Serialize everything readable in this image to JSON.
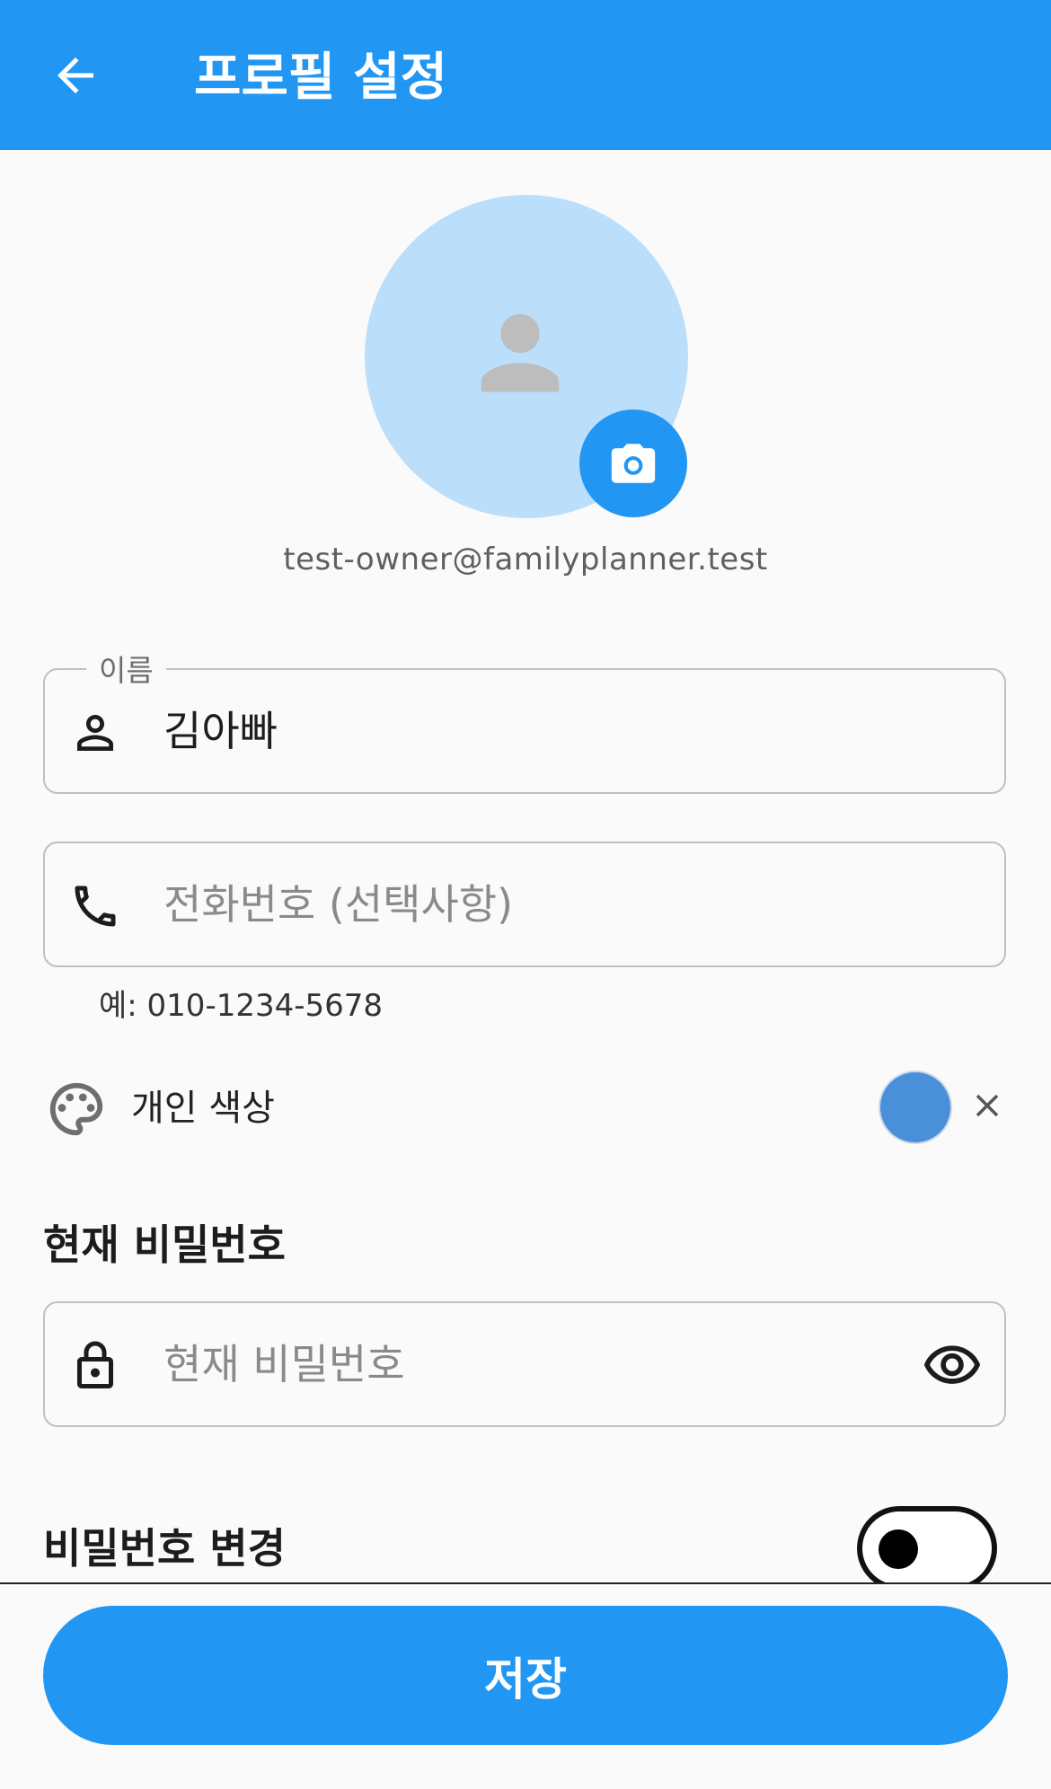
{
  "header": {
    "title": "프로필 설정",
    "back_icon": "arrow-back-icon"
  },
  "profile": {
    "email": "test-owner@familyplanner.test",
    "avatar_icon": "person-icon",
    "camera_icon": "camera-icon"
  },
  "form": {
    "name": {
      "label": "이름",
      "value": "김아빠",
      "icon": "person-outline-icon"
    },
    "phone": {
      "placeholder": "전화번호 (선택사항)",
      "helper": "예: 010-1234-5678",
      "icon": "phone-icon"
    },
    "color": {
      "label": "개인 색상",
      "value": "#4A90D9",
      "icon": "palette-icon",
      "clear_icon": "close-icon"
    },
    "current_password": {
      "heading": "현재 비밀번호",
      "placeholder": "현재 비밀번호",
      "icon": "lock-icon",
      "visibility_icon": "eye-icon"
    },
    "change_password": {
      "label": "비밀번호 변경",
      "enabled": false
    }
  },
  "actions": {
    "save_label": "저장"
  },
  "colors": {
    "primary": "#2196F3",
    "avatar_bg": "#BBDEFB",
    "background": "#FAFAFA"
  }
}
